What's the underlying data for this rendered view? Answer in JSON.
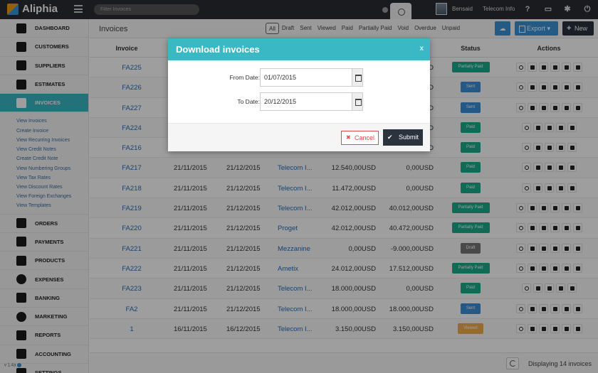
{
  "app": {
    "name": "Aliphia"
  },
  "search": {
    "placeholder": "Filter Invoices"
  },
  "user": {
    "name": "Bensaid",
    "org": "Telecom Info"
  },
  "sidebar": {
    "items": [
      {
        "label": "DASHBOARD",
        "icon": "dashboard-icon"
      },
      {
        "label": "CUSTOMERS",
        "icon": "user-icon"
      },
      {
        "label": "SUPPLIERS",
        "icon": "suppliers-icon"
      },
      {
        "label": "ESTIMATES",
        "icon": "calculator-icon"
      },
      {
        "label": "INVOICES",
        "icon": "invoice-icon"
      }
    ],
    "subitems": [
      "View Invoices",
      "Create Invoice",
      "View Recurring Invoices",
      "View Credit Notes",
      "Create Credit Note",
      "View Numbering Groups",
      "View Tax Rates",
      "View Discount Rates",
      "View Foreign Exchanges",
      "View Templates"
    ],
    "items2": [
      {
        "label": "ORDERS",
        "icon": "briefcase-icon"
      },
      {
        "label": "PAYMENTS",
        "icon": "credit-card-icon"
      },
      {
        "label": "PRODUCTS",
        "icon": "box-icon"
      },
      {
        "label": "EXPENSES",
        "icon": "dollar-icon"
      },
      {
        "label": "BANKING",
        "icon": "bank-icon"
      },
      {
        "label": "MARKETING",
        "icon": "target-icon"
      },
      {
        "label": "REPORTS",
        "icon": "bar-chart-icon"
      },
      {
        "label": "ACCOUNTING",
        "icon": "scale-icon"
      },
      {
        "label": "SETTINGS",
        "icon": "gear-icon"
      }
    ],
    "version": "v 1.4a"
  },
  "toolbar": {
    "title": "Invoices",
    "filters": [
      "All",
      "Draft",
      "Sent",
      "Viewed",
      "Paid",
      "Partially Paid",
      "Void",
      "Overdue",
      "Unpaid"
    ],
    "export_label": "Export",
    "new_label": "New"
  },
  "table": {
    "headers": {
      "invoice": "Invoice",
      "status": "Status",
      "actions": "Actions"
    },
    "rows": [
      {
        "invoice": "FA225",
        "date": "",
        "due": "",
        "customer": "",
        "total": "",
        "balance": "USD",
        "status": "Partially Paid",
        "color": "#1aab8a",
        "acts": 6
      },
      {
        "invoice": "FA226",
        "date": "",
        "due": "",
        "customer": "",
        "total": "",
        "balance": "USD",
        "status": "Sent",
        "color": "#3a8fd9",
        "acts": 6
      },
      {
        "invoice": "FA227",
        "date": "",
        "due": "",
        "customer": "",
        "total": "",
        "balance": "USD",
        "status": "Sent",
        "color": "#3a8fd9",
        "acts": 6
      },
      {
        "invoice": "FA224",
        "date": "",
        "due": "",
        "customer": "",
        "total": "",
        "balance": "USD",
        "status": "Paid",
        "color": "#1aab8a",
        "acts": 5
      },
      {
        "invoice": "FA216",
        "date": "",
        "due": "",
        "customer": "",
        "total": "",
        "balance": "USD",
        "status": "Paid",
        "color": "#1aab8a",
        "acts": 5
      },
      {
        "invoice": "FA217",
        "date": "21/11/2015",
        "due": "21/12/2015",
        "customer": "Telecom I...",
        "total": "12.540,00USD",
        "balance": "0,00USD",
        "status": "Paid",
        "color": "#1aab8a",
        "acts": 5
      },
      {
        "invoice": "FA218",
        "date": "21/11/2015",
        "due": "21/12/2015",
        "customer": "Telecom I...",
        "total": "11.472,00USD",
        "balance": "0,00USD",
        "status": "Paid",
        "color": "#1aab8a",
        "acts": 5
      },
      {
        "invoice": "FA219",
        "date": "21/11/2015",
        "due": "21/12/2015",
        "customer": "Telecom I...",
        "total": "42.012,00USD",
        "balance": "40.012,00USD",
        "status": "Partially Paid",
        "color": "#1aab8a",
        "acts": 6
      },
      {
        "invoice": "FA220",
        "date": "21/11/2015",
        "due": "21/12/2015",
        "customer": "Proget",
        "total": "42.012,00USD",
        "balance": "40.472,00USD",
        "status": "Partially Paid",
        "color": "#1aab8a",
        "acts": 6
      },
      {
        "invoice": "FA221",
        "date": "21/11/2015",
        "due": "21/12/2015",
        "customer": "Mezzanine",
        "total": "0,00USD",
        "balance": "-9.000,00USD",
        "status": "Draft",
        "color": "#777777",
        "acts": 6
      },
      {
        "invoice": "FA222",
        "date": "21/11/2015",
        "due": "21/12/2015",
        "customer": "Ametix",
        "total": "24.012,00USD",
        "balance": "17.512,00USD",
        "status": "Partially Paid",
        "color": "#1aab8a",
        "acts": 6
      },
      {
        "invoice": "FA223",
        "date": "21/11/2015",
        "due": "21/12/2015",
        "customer": "Telecom I...",
        "total": "18.000,00USD",
        "balance": "0,00USD",
        "status": "Paid",
        "color": "#1aab8a",
        "acts": 5
      },
      {
        "invoice": "FA2",
        "date": "21/11/2015",
        "due": "21/12/2015",
        "customer": "Telecom I...",
        "total": "18.000,00USD",
        "balance": "18.000,00USD",
        "status": "Sent",
        "color": "#3a8fd9",
        "acts": 6
      },
      {
        "invoice": "1",
        "date": "16/11/2015",
        "due": "16/12/2015",
        "customer": "Telecom I...",
        "total": "3.150,00USD",
        "balance": "3.150,00USD",
        "status": "Viewed",
        "color": "#f0ad4e",
        "acts": 6
      }
    ]
  },
  "footer": {
    "displaying": "Displaying 14 invoices"
  },
  "modal": {
    "title": "Download invoices",
    "close": "x",
    "from_label": "From Date:",
    "from_value": "01/07/2015",
    "to_label": "To Date:",
    "to_value": "20/12/2015",
    "cancel_label": "Cancel",
    "submit_label": "Submit"
  }
}
